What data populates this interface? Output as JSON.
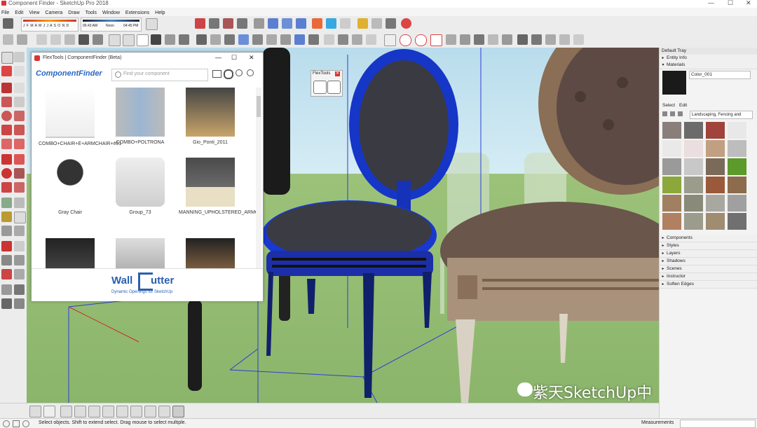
{
  "window": {
    "title": "Component Finder - SketchUp Pro 2018",
    "min": "—",
    "max": "☐",
    "close": "✕"
  },
  "menu": [
    "File",
    "Edit",
    "View",
    "Camera",
    "Draw",
    "Tools",
    "Window",
    "Extensions",
    "Help"
  ],
  "shadow_bar": {
    "months": "J F M A M J J A S O N D",
    "time_start": "06:43 AM",
    "time_mid": "Noon",
    "time_end": "04:45 PM"
  },
  "component_finder": {
    "title": "FlexTools | ComponentFinder (Beta)",
    "logo": "ComponentFinder",
    "search_placeholder": "Find your component",
    "items": [
      {
        "label": "COMBO+CHAIR+E+ARMCHAIR+#01"
      },
      {
        "label": "COMBO+POLTRONA"
      },
      {
        "label": "Gio_Ponti_2011"
      },
      {
        "label": "Gray Chair"
      },
      {
        "label": "Group_73"
      },
      {
        "label": "MANNING_UPHOLSTERED_ARMCHAIR"
      }
    ],
    "banner_title_a": "Wall",
    "banner_title_b": "utter",
    "banner_sub": "Dynamic Openings for SketchUp"
  },
  "flextools_mini": {
    "title": "FlexTools"
  },
  "tray": {
    "title": "Default Tray",
    "entity_info": "Entity Info",
    "materials": "Materials",
    "material_name": "Color_001",
    "select_tab": "Select",
    "edit_tab": "Edit",
    "collection": "Landscaping, Fencing and",
    "sections": [
      "Components",
      "Styles",
      "Layers",
      "Shadows",
      "Scenes",
      "Instructor",
      "Soften Edges"
    ],
    "swatch_colors": [
      "#8a7e7a",
      "#6b6b6b",
      "#a0433a",
      "#e8e8e8",
      "#e9e9e9",
      "#eadede",
      "#c0a080",
      "#bdbdbd",
      "#9a9a9a",
      "#c8c8c8",
      "#7a6a5a",
      "#5c9a2c",
      "#8ca83a",
      "#9c9c8c",
      "#9a5a3a",
      "#8c6c4c",
      "#a08060",
      "#8a8a7a",
      "#a8a8a0",
      "#a0a0a0",
      "#b08060",
      "#9c9c8c",
      "#a08c70",
      "#707070"
    ]
  },
  "status": {
    "text": "Select objects. Shift to extend select. Drag mouse to select multiple.",
    "measurements_label": "Measurements"
  },
  "watermark": "紫天SketchUp中文网"
}
